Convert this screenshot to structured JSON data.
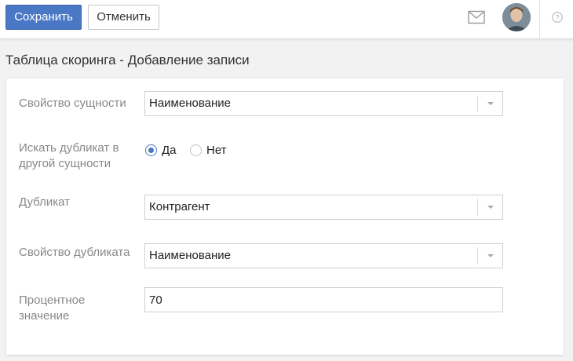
{
  "toolbar": {
    "save_label": "Сохранить",
    "cancel_label": "Отменить"
  },
  "header": {
    "icons": [
      "mail-icon",
      "avatar",
      "help-icon"
    ]
  },
  "page": {
    "title": "Таблица скоринга - Добавление записи"
  },
  "form": {
    "entity_property": {
      "label": "Свойство сущности",
      "value": "Наименование"
    },
    "search_duplicate": {
      "label": "Искать дубликат в другой сущности",
      "options": [
        "Да",
        "Нет"
      ],
      "selected": "Да"
    },
    "duplicate": {
      "label": "Дубликат",
      "value": "Контрагент"
    },
    "duplicate_property": {
      "label": "Свойство дубликата",
      "value": "Наименование"
    },
    "percent_value": {
      "label": "Процентное значение",
      "value": "70"
    }
  },
  "colors": {
    "accent": "#4a78c5",
    "background": "#f2f2f2",
    "label": "#888888"
  }
}
